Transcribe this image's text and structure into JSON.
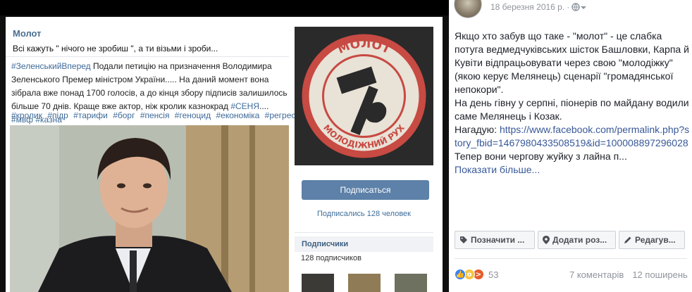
{
  "vk": {
    "group_name": "Молот",
    "group_status": "Всі кажуть \" нічого не зробиш \", а ти візьми і зроби...",
    "post_tag_start": "#ЗеленськийВперед",
    "post_text_1": " Подали петицію на призначення Володимира Зеленського Премер міністром України..... На даний момент вона зібрала вже понад 1700 голосів, а до кінця збору підписів залишилось більше 70 днів. Краще вже актор, ніж кролик казнокрад ",
    "post_tag_mid": "#СЕНЯ",
    "post_text_2": ".... ",
    "post_tag_end": "#мвф #казна",
    "tags": [
      "#кролик",
      "#підр",
      "#тарифи",
      "#борг",
      "#пенсія",
      "#геноцид",
      "#економіка",
      "#регрес"
    ],
    "logo_top": "МОЛОТ",
    "logo_bottom": "МОЛОДІЖНИЙ РУХ",
    "subscribe_button": "Подписаться",
    "subscribed_text": "Подписались 128 человек",
    "subscribers_header": "Подписчики",
    "subscribers_count": "128 подписчиков",
    "colors": {
      "vk_blue": "#5d81a8",
      "link": "#3e6a99"
    }
  },
  "fb": {
    "date": "18 березня 2016 р.",
    "meta_sep": "·",
    "audience_icon": "globe-icon",
    "text_1": "Якщо хто забув що таке - \"молот\" - це слабка потуга ведмедчуківських шісток Башловки, Карпа й Кувіти відпрацьовувати через свою \"молодіжку\" (якою керує Мелянець) сценарії \"громадянської непокори\".",
    "text_2": "На день гівну у серпні, піонерів по майдану водили саме Мелянець і Козак.",
    "text_3_label": "Нагадую: ",
    "link": "https://www.facebook.com/permalink.php?story_fbid=1467980433508519&id=100008897296028",
    "text_4": "Тепер вони чергову жуйку з лайна п...",
    "show_more": "Показати більше...",
    "actions": {
      "tag": "Позначити ...",
      "place": "Додати роз...",
      "edit": "Редагув..."
    },
    "reaction_count": "53",
    "comments": "7 коментарів",
    "shares": "12 поширень",
    "colors": {
      "link": "#385898",
      "muted": "#90949c"
    }
  }
}
